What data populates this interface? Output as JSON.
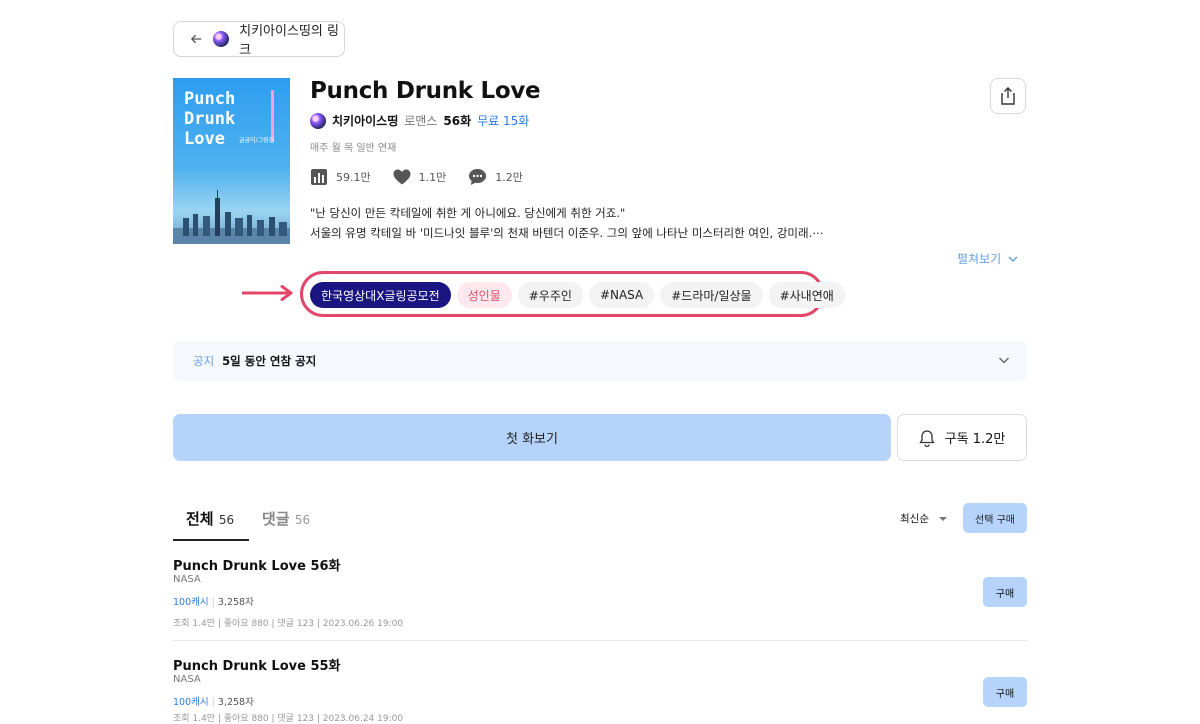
{
  "back": {
    "label": "치키아이스띵의 링크"
  },
  "work": {
    "cover_title": [
      "Punch",
      "Drunk",
      "Love"
    ],
    "cover_subtitle": "글굽이/그림김",
    "title": "Punch Drunk Love",
    "author": "치키아이스띵",
    "genre": "로맨스",
    "episodes": "56화",
    "free": "무료 15화",
    "schedule": "매주 월 목 일반 연재",
    "views": "59.1만",
    "likes": "1.1만",
    "comments": "1.2만",
    "desc_line1": "\"난 당신이 만든 칵테일에 취한 게 아니에요. 당신에게 취한 거죠.\"",
    "desc_line2": "서울의 유명 칵테일 바 '미드나잇 블루'의 천재 바텐더 이준우. 그의 앞에 나타난 미스터리한 여인, 강미래.⋯",
    "more_label": "펼쳐보기"
  },
  "tags": [
    {
      "label": "한국영상대X글링공모전",
      "style": "dark"
    },
    {
      "label": "성인물",
      "style": "pink"
    },
    {
      "label": "#우주인",
      "style": "plain"
    },
    {
      "label": "#NASA",
      "style": "plain"
    },
    {
      "label": "#드라마/일상물",
      "style": "plain"
    },
    {
      "label": "#사내연애",
      "style": "plain"
    }
  ],
  "notice": {
    "label": "공지",
    "text": "5일 동안 연참 공지"
  },
  "actions": {
    "first_view": "첫 화보기",
    "subscribe": "구독 1.2만"
  },
  "tabs": {
    "all_label": "전체",
    "all_count": "56",
    "comments_label": "댓글",
    "comments_count": "56"
  },
  "sort": {
    "label": "최신순",
    "select_buy": "선택 구매"
  },
  "episodes": [
    {
      "title": "Punch Drunk Love 56화",
      "sub": "NASA",
      "cash": "100캐시",
      "chars": "3,258자",
      "info": "조회 1.4만 | 좋아요 880 | 댓글 123 | 2023.06.26 19:00",
      "buy": "구매"
    },
    {
      "title": "Punch Drunk Love 55화",
      "sub": "NASA",
      "cash": "100캐시",
      "chars": "3,258자",
      "info": "조회 1.4만 | 좋아요 880 | 댓글 123 | 2023.06.24 19:00",
      "buy": "구매"
    }
  ],
  "colors": {
    "accent": "#2a7be4",
    "button_blue": "#b5d3fb",
    "highlight_ring": "#e4466a",
    "tag_dark": "#1a1580"
  }
}
